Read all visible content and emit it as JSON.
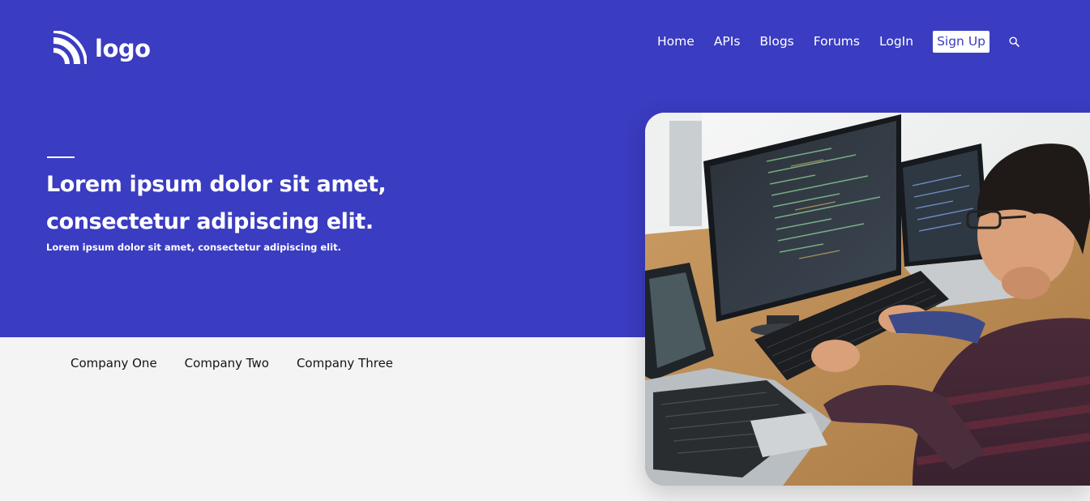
{
  "brand": {
    "logo_text": "logo",
    "logo_icon": "wifi-arcs-icon"
  },
  "nav": {
    "items": [
      {
        "label": "Home"
      },
      {
        "label": "APIs"
      },
      {
        "label": "Blogs"
      },
      {
        "label": "Forums"
      },
      {
        "label": "LogIn"
      }
    ],
    "signup_label": "Sign Up",
    "search_icon": "search-icon"
  },
  "hero": {
    "title_line1": "Lorem ipsum dolor sit amet,",
    "title_line2": "consectetur adipiscing elit.",
    "subtitle": "Lorem ipsum dolor sit amet, consectetur adipiscing elit.",
    "image": "developer-at-computer-photo"
  },
  "companies": [
    {
      "name": "Company One"
    },
    {
      "name": "Company Two"
    },
    {
      "name": "Company Three"
    }
  ],
  "colors": {
    "primary": "#3a3cc1",
    "background": "#f4f4f4",
    "text_light": "#ffffff",
    "text_dark": "#141414"
  }
}
